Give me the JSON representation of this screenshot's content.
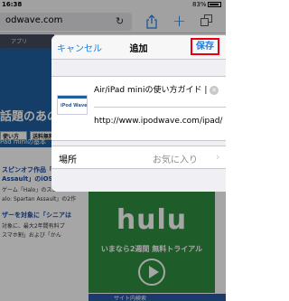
{
  "status": {
    "time": "16:38",
    "battery": "83%"
  },
  "browser": {
    "url": "odwave.com",
    "reload_icon": "reload-icon",
    "share_icon": "share-icon",
    "new_tab_icon": "plus-icon",
    "tabs_icon": "tabs-icon",
    "accent": "#1a7ee6"
  },
  "page": {
    "menu_label": "アプリ",
    "headline": "話題のあの",
    "pill_1": "使い方",
    "pill_2": "送料無料",
    "subhead": "Pad miniの基本",
    "articles": [
      {
        "title": "スピンオフ作品「H",
        "body": ""
      },
      {
        "title": "Assault」のiOS版を配信開",
        "body": ""
      },
      {
        "title": "",
        "body": "ゲーム「Halo」のスピンオ"
      },
      {
        "title": "",
        "body": "alo: Spartan Assault」の2作"
      },
      {
        "title": "ザーを対象に「シニアは",
        "body": ""
      },
      {
        "title": "",
        "body": "対象に、最大2年間有料プ"
      },
      {
        "title": "",
        "body": "スマホ割」および「かん"
      }
    ],
    "ad": {
      "logo": "hulu",
      "tagline": "いまなら2週間 無料トライアル",
      "color": "#2e8f3f"
    },
    "sidebar_search": "サイト内検索"
  },
  "dialog": {
    "cancel_label": "キャンセル",
    "title": "追加",
    "save_label": "保存",
    "save_highlight_color": "#e60012",
    "thumbnail_brand": "iPod Wave",
    "bookmark_title": "Air/iPad miniの使い方ガイド |",
    "bookmark_url": "http://www.ipodwave.com/ipad/",
    "location_label": "場所",
    "location_value": "お気に入り"
  }
}
